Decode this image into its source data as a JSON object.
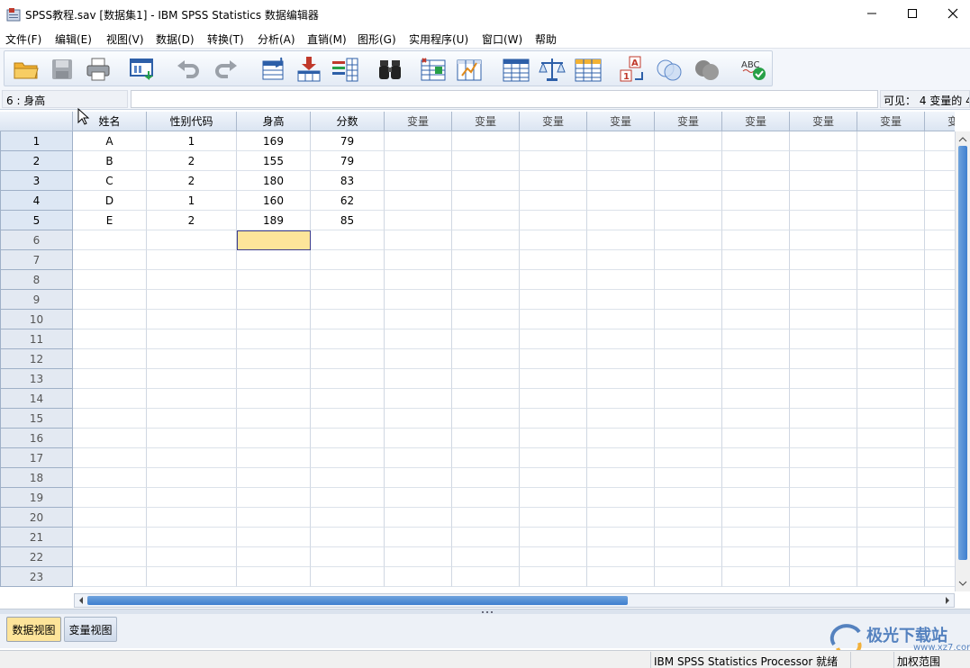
{
  "window": {
    "title": "SPSS教程.sav [数据集1] - IBM SPSS Statistics 数据编辑器",
    "controls": [
      "minimize",
      "maximize",
      "close"
    ]
  },
  "menu": [
    "文件(F)",
    "编辑(E)",
    "视图(V)",
    "数据(D)",
    "转换(T)",
    "分析(A)",
    "直销(M)",
    "图形(G)",
    "实用程序(U)",
    "窗口(W)",
    "帮助"
  ],
  "toolbar": [
    "open-icon",
    "save-icon",
    "print-icon",
    "recall-dialog-icon",
    "undo-icon",
    "redo-icon",
    "goto-case-icon",
    "goto-variable-icon",
    "variables-icon",
    "find-icon",
    "insert-cases-icon",
    "insert-variable-icon",
    "split-file-icon",
    "weight-cases-icon",
    "select-cases-icon",
    "value-labels-icon",
    "use-sets-icon",
    "show-all-variables-icon",
    "spell-check-icon"
  ],
  "refbar": {
    "cell_ref": "6 : 身高",
    "value": "",
    "visible": "可见： 4 变量的 4"
  },
  "grid": {
    "columns": [
      "姓名",
      "性别代码",
      "身高",
      "分数"
    ],
    "empty_column_label": "变量",
    "empty_columns": 9,
    "row_numbers": [
      "1",
      "2",
      "3",
      "4",
      "5",
      "6",
      "7",
      "8",
      "9",
      "10",
      "11",
      "12",
      "13",
      "14",
      "15",
      "16",
      "17",
      "18",
      "19",
      "20",
      "21",
      "22",
      "23"
    ],
    "rows": [
      [
        "A",
        "1",
        "169",
        "79"
      ],
      [
        "B",
        "2",
        "155",
        "79"
      ],
      [
        "C",
        "2",
        "180",
        "83"
      ],
      [
        "D",
        "1",
        "160",
        "62"
      ],
      [
        "E",
        "2",
        "189",
        "85"
      ]
    ],
    "active_cell": {
      "row": 6,
      "column": "身高"
    }
  },
  "tabs": {
    "data_view": "数据视图",
    "variable_view": "变量视图"
  },
  "status": {
    "processor": "IBM SPSS Statistics Processor 就绪",
    "weight": "加权范围"
  },
  "watermark": {
    "text": "极光下载站",
    "url": "www.xz7.com"
  },
  "colors": {
    "active_cell": "#fde59a",
    "active_tab": "#fde49a",
    "scroll_thumb": "#3f7fcf",
    "header_bg": "#dbe5f2"
  }
}
